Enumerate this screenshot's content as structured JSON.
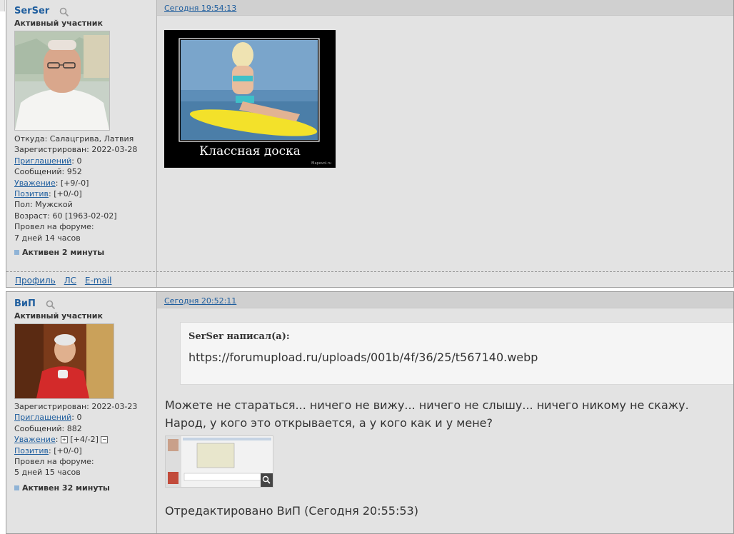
{
  "post1": {
    "username": "SerSer",
    "rank": "Активный участник",
    "info": [
      "Откуда: Салацгрива, Латвия",
      "Зарегистрирован: 2022-03-28"
    ],
    "invites_label": "Приглашений",
    "invites_value": ": 0",
    "messages": "Сообщений: 952",
    "respect_label": "Уважение",
    "respect_value": ": [+9/-0]",
    "positive_label": "Позитив",
    "positive_value": ": [+0/-0]",
    "gender": "Пол: Мужской",
    "age": "Возраст: 60 [1963-02-02]",
    "time_label": "Провел на форуме:",
    "time_value": "7 дней 14 часов",
    "status": "Активен 2 минуты",
    "links": {
      "profile": "Профиль",
      "pm": "ЛС",
      "email": "E-mail"
    },
    "date": "Сегодня 19:54:13",
    "image_caption": "Классная доска",
    "image_watermark": "Mapevol.ru"
  },
  "post2": {
    "username": "ВиП",
    "rank": "Активный участник",
    "registered": "Зарегистрирован: 2022-03-23",
    "invites_label": "Приглашений",
    "invites_value": ": 0",
    "messages": "Сообщений: 882",
    "respect_label": "Уважение",
    "respect_value": "[+4/-2]",
    "positive_label": "Позитив",
    "positive_value": ": [+0/-0]",
    "time_label": "Провел на форуме:",
    "time_value": "5 дней 15 часов",
    "status": "Активен 32 минуты",
    "date": "Сегодня 20:52:11",
    "quote_author": "SerSer написал(а):",
    "quote_text": "https://forumupload.ru/uploads/001b/4f/36/25/t567140.webp",
    "message_line1": "Можете не стараться... ничего не вижу... ничего не слышу... ничего никому не скажу.",
    "message_line2": "Народ, у кого это открывается, а у кого как и у мене?",
    "edited": "Отредактировано ВиП (Сегодня 20:55:53)"
  },
  "colors": {
    "link": "#1f5e9e",
    "post_bg": "#e3e3e3",
    "datebar": "#d0d0d0"
  }
}
